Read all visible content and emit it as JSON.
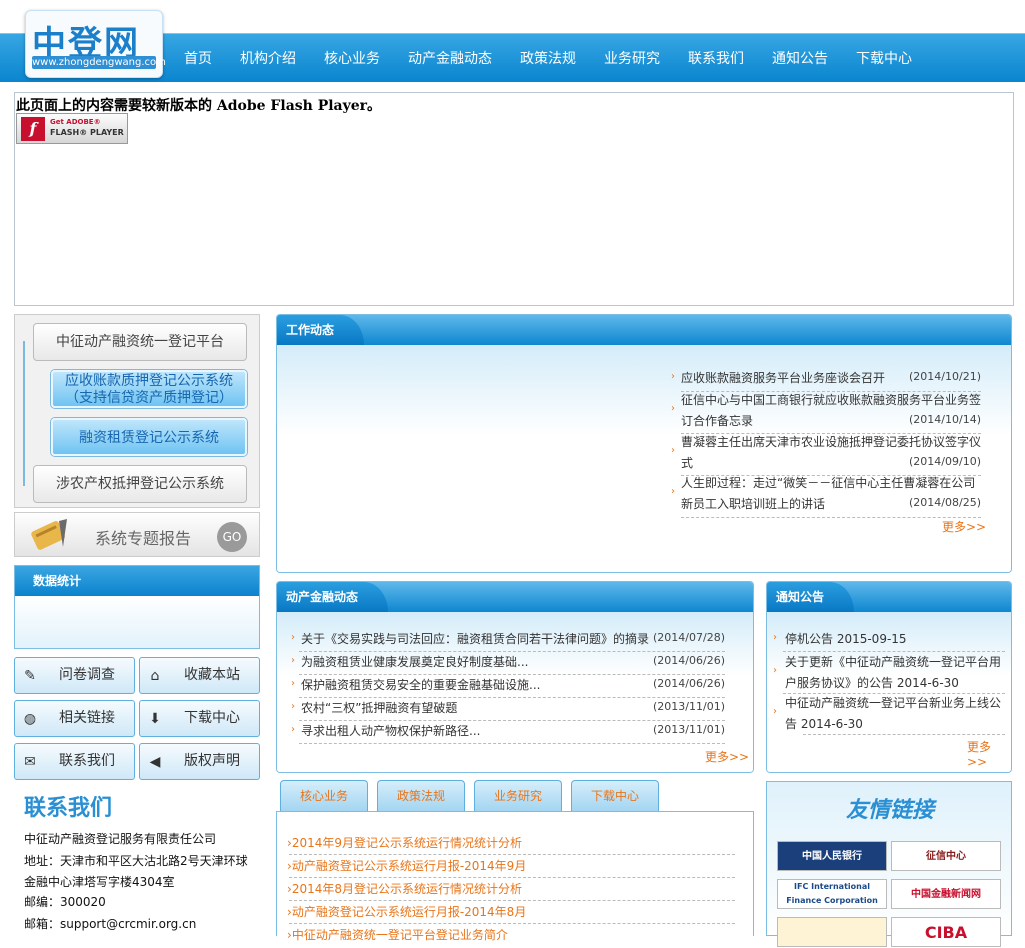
{
  "header": {
    "logo_cn": "中登网",
    "logo_url": "www.zhongdengwang.com",
    "nav": [
      "首页",
      "机构介绍",
      "核心业务",
      "动产金融动态",
      "政策法规",
      "业务研究",
      "联系我们",
      "通知公告",
      "下载中心"
    ]
  },
  "flash": {
    "message": "此页面上的内容需要较新版本的 Adobe Flash Player。",
    "button_line1": "Get ADOBE®",
    "button_line2": "FLASH® PLAYER",
    "button_icon": "flash-logo-icon"
  },
  "platform": {
    "items": [
      "中征动产融资统一登记平台",
      "应收账款质押登记公示系统",
      "（支持信贷资产质押登记）",
      "融资租赁登记公示系统",
      "涉农产权抵押登记公示系统"
    ]
  },
  "report": {
    "label": "系统专题报告",
    "go": "GO"
  },
  "stats": {
    "title": "数据统计"
  },
  "quick_buttons": [
    {
      "label": "问卷调查",
      "icon": "survey-icon"
    },
    {
      "label": "收藏本站",
      "icon": "home-icon"
    },
    {
      "label": "相关链接",
      "icon": "globe-link-icon"
    },
    {
      "label": "下载中心",
      "icon": "download-icon"
    },
    {
      "label": "联系我们",
      "icon": "contact-icon"
    },
    {
      "label": "版权声明",
      "icon": "speaker-icon"
    }
  ],
  "contact": {
    "title": "联系我们",
    "lines": [
      "中征动产融资登记服务有限责任公司",
      "地址：天津市和平区大沽北路2号天津环球",
      "金融中心津塔写字楼4304室",
      "邮编：300020",
      "邮箱：support@crcmir.org.cn"
    ]
  },
  "work": {
    "title": "工作动态",
    "items": [
      {
        "line1": "应收账款融资服务平台业务座谈会召开",
        "line2": "",
        "date": "(2014/10/21)"
      },
      {
        "line1": "征信中心与中国工商银行就应收账款融资服务平台业务签",
        "line2": "订合作备忘录",
        "date": "(2014/10/14)"
      },
      {
        "line1": "曹凝蓉主任出席天津市农业设施抵押登记委托协议签字仪",
        "line2": "式",
        "date": "(2014/09/10)"
      },
      {
        "line1": "人生即过程：走过“微笑－－征信中心主任曹凝蓉在公司",
        "line2": "新员工入职培训班上的讲话",
        "date": "(2014/08/25)"
      }
    ],
    "more": "更多>>"
  },
  "finance": {
    "title": "动产金融动态",
    "items": [
      {
        "title": "关于《交易实践与司法回应：融资租赁合同若干法律问题》的摘录",
        "date": "(2014/07/28)"
      },
      {
        "title": "为融资租赁业健康发展奠定良好制度基础...",
        "date": "(2014/06/26)"
      },
      {
        "title": "保护融资租赁交易安全的重要金融基础设施...",
        "date": "(2014/06/26)"
      },
      {
        "title": "农村“三权”抵押融资有望破题",
        "date": "(2013/11/01)"
      },
      {
        "title": "寻求出租人动产物权保护新路径...",
        "date": "(2013/11/01)"
      }
    ],
    "more": "更多>>"
  },
  "notice": {
    "title": "通知公告",
    "items": [
      {
        "line1": "停机公告  2015-09-15",
        "line2": ""
      },
      {
        "line1": "关于更新《中征动产融资统一登记平台用",
        "line2": "户服务协议》的公告  2014-6-30"
      },
      {
        "line1": "中征动产融资统一登记平台新业务上线公",
        "line2": "告  2014-6-30"
      }
    ],
    "more": "更多>>"
  },
  "subtabs": {
    "tabs": [
      "核心业务",
      "政策法规",
      "业务研究",
      "下载中心"
    ],
    "items": [
      "2014年9月登记公示系统运行情况统计分析",
      "动产融资登记公示系统运行月报-2014年9月",
      "2014年8月登记公示系统运行情况统计分析",
      "动产融资登记公示系统运行月报-2014年8月",
      "中征动产融资统一登记平台登记业务简介"
    ]
  },
  "friend_links": {
    "title": "友情链接",
    "items": [
      {
        "label": "中国人民银行",
        "color": "#1a3f7a",
        "text_color": "#ffffff"
      },
      {
        "label": "征信中心",
        "color": "#ffffff",
        "text_color": "#8a1b1b"
      },
      {
        "label": "IFC International Finance Corporation",
        "color": "#ffffff",
        "text_color": "#1a4a8a"
      },
      {
        "label": "中国金融新闻网",
        "color": "#ffffff",
        "text_color": "#c8102e"
      },
      {
        "label": "",
        "color": "#fff3d6",
        "text_color": "#c8102e"
      },
      {
        "label": "CIBA",
        "color": "#ffffff",
        "text_color": "#c8102e"
      }
    ]
  },
  "colors": {
    "accent": "#0e87d0",
    "more": "#e8751a"
  }
}
